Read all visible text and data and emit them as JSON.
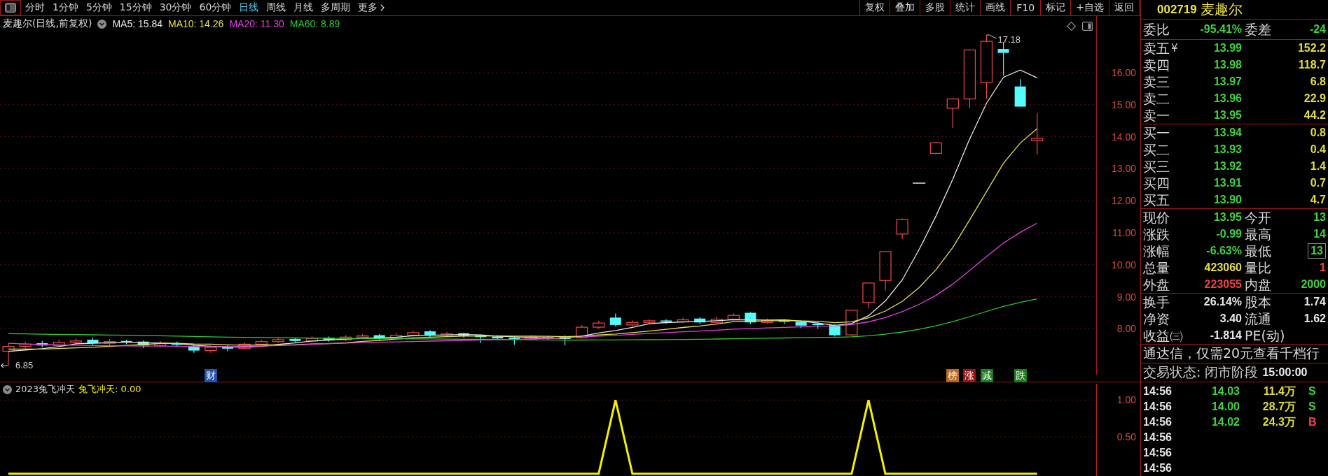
{
  "toolbar": {
    "tabs": [
      {
        "label": "分时",
        "kind": "tab",
        "selected": false
      },
      {
        "label": "1分钟",
        "kind": "tab",
        "selected": false
      },
      {
        "label": "5分钟",
        "kind": "tab",
        "selected": false
      },
      {
        "label": "15分钟",
        "kind": "tab",
        "selected": false
      },
      {
        "label": "30分钟",
        "kind": "tab",
        "selected": false
      },
      {
        "label": "60分钟",
        "kind": "tab",
        "selected": false
      },
      {
        "label": "日线",
        "kind": "tab",
        "selected": true
      },
      {
        "label": "周线",
        "kind": "tab",
        "selected": false
      },
      {
        "label": "月线",
        "kind": "tab",
        "selected": false
      },
      {
        "label": "多周期",
        "kind": "tab",
        "selected": false
      },
      {
        "label": "更多",
        "kind": "menu",
        "selected": false
      }
    ],
    "buttons": [
      "复权",
      "叠加",
      "多股",
      "统计",
      "画线",
      "F10",
      "标记",
      "+自选",
      "返回"
    ]
  },
  "main_chart": {
    "title": "麦趣尔(日线,前复权)",
    "moving_averages": [
      {
        "label": "MA5: 15.84",
        "color": "#e6e6e6"
      },
      {
        "label": "MA10: 14.26",
        "color": "#e6e048"
      },
      {
        "label": "MA20: 11.30",
        "color": "#e040e0"
      },
      {
        "label": "MA60: 8.89",
        "color": "#2ec82e"
      }
    ],
    "high_label": "17.18",
    "low_label": "6.85",
    "price_axis": [
      "16.00",
      "15.00",
      "14.00",
      "13.00",
      "12.00",
      "11.00",
      "10.00",
      "9.00",
      "8.00"
    ],
    "markers": [
      {
        "label": "财",
        "color": "#2452a8"
      },
      {
        "label": "榜",
        "color": "#b8681c"
      },
      {
        "label": "涨",
        "color": "#9a1414"
      },
      {
        "label": "减",
        "color": "#1c7e1c"
      },
      {
        "label": "跌",
        "color": "#1c7e1c"
      }
    ]
  },
  "indicator": {
    "name": "2023兔飞冲天",
    "legend": "兔飞冲天: 0.00",
    "chart_data": {
      "type": "line",
      "categories": [
        null,
        null,
        null,
        null,
        null,
        null,
        null,
        null,
        null,
        null,
        null,
        null,
        null,
        null,
        null,
        null,
        null,
        null,
        null,
        null,
        null,
        null,
        null,
        null,
        null,
        null,
        null,
        null,
        null,
        null,
        null,
        null,
        null,
        null,
        null,
        null,
        null,
        null,
        null,
        null,
        null,
        null,
        null,
        null,
        null,
        null,
        null,
        null,
        null,
        null,
        null,
        null,
        null,
        null,
        null,
        null,
        null,
        null,
        null,
        null,
        null,
        null,
        null,
        null,
        null
      ],
      "values": [
        0,
        0,
        0,
        0,
        0,
        0,
        0,
        0,
        0,
        0,
        0,
        0,
        0,
        0,
        0,
        0,
        0,
        0,
        0,
        0,
        0,
        0,
        0,
        0,
        0,
        0,
        0,
        0,
        0,
        0,
        0,
        0,
        0,
        0,
        0,
        0,
        1,
        0,
        0,
        0,
        0,
        0,
        0,
        0,
        0,
        0,
        0,
        0,
        0,
        0,
        0,
        1,
        0,
        0,
        0,
        0,
        0,
        0,
        0,
        0,
        0,
        0,
        null,
        null,
        null
      ],
      "ylim": [
        -0.03,
        1.24
      ],
      "yticks": [
        {
          "value": 1,
          "label": "1.00"
        },
        {
          "value": 0.5,
          "label": "0.50"
        }
      ]
    }
  },
  "quote_panel": {
    "code": "002719",
    "name": "麦趣尔",
    "ratio": [
      {
        "label": "委比",
        "value": "-95.41%",
        "color": "#3cd43c"
      },
      {
        "label": "委差",
        "value": "-24",
        "color": "#3cd43c"
      }
    ],
    "asks": [
      {
        "label": "卖五",
        "tag": "¥",
        "price": "13.99",
        "volume": "152.2"
      },
      {
        "label": "卖四",
        "price": "13.98",
        "volume": "118.7"
      },
      {
        "label": "卖三",
        "price": "13.97",
        "volume": "6.8"
      },
      {
        "label": "卖二",
        "price": "13.96",
        "volume": "22.9"
      },
      {
        "label": "卖一",
        "price": "13.95",
        "volume": "44.2"
      }
    ],
    "bids": [
      {
        "label": "买一",
        "price": "13.94",
        "volume": "0.8"
      },
      {
        "label": "买二",
        "price": "13.93",
        "volume": "0.4"
      },
      {
        "label": "买三",
        "price": "13.92",
        "volume": "1.4"
      },
      {
        "label": "买四",
        "price": "13.91",
        "volume": "0.7"
      },
      {
        "label": "买五",
        "price": "13.90",
        "volume": "4.7"
      }
    ],
    "quote": [
      {
        "label": "现价",
        "value": "13.95",
        "color": "#3cd43c",
        "highlighted": false
      },
      {
        "label": "今开",
        "value": "13",
        "color": "#3cd43c",
        "highlighted": false
      },
      {
        "label": "涨跌",
        "value": "-0.99",
        "color": "#3cd43c",
        "highlighted": false
      },
      {
        "label": "最高",
        "value": "14",
        "color": "#3cd43c",
        "highlighted": false
      },
      {
        "label": "涨幅",
        "value": "-6.63%",
        "color": "#3cd43c",
        "highlighted": false
      },
      {
        "label": "最低",
        "value": "13",
        "color": "#3cd43c",
        "highlighted": true
      },
      {
        "label": "总量",
        "value": "423060",
        "color": "#e4dc3c",
        "highlighted": false
      },
      {
        "label": "量比",
        "value": "1",
        "color": "#f04444",
        "highlighted": false
      },
      {
        "label": "外盘",
        "value": "223055",
        "color": "#f04444",
        "highlighted": false
      },
      {
        "label": "内盘",
        "value": "2000",
        "color": "#3cd43c",
        "highlighted": false
      }
    ],
    "fundamentals": [
      {
        "label": "换手",
        "value": "26.14%"
      },
      {
        "label": "股本",
        "value": "1.74"
      },
      {
        "label": "净资",
        "value": "3.40"
      },
      {
        "label": "流通",
        "value": "1.62"
      },
      {
        "label": "收益㈢",
        "value": "-1.814"
      },
      {
        "label": "PE(动)"
      }
    ],
    "notice": "通达信，仅需20元查看千档行",
    "status": "交易状态: 闭市阶段",
    "status_time": "15:00:00",
    "ticks": [
      {
        "time": "14:56",
        "price": "14.03",
        "volume": "11.4万",
        "side": "S",
        "color": "#3cd43c"
      },
      {
        "time": "14:56",
        "price": "14.00",
        "volume": "28.7万",
        "side": "S",
        "color": "#3cd43c"
      },
      {
        "time": "14:56",
        "price": "14.02",
        "volume": "24.3万",
        "side": "B",
        "color": "#f04444"
      },
      {
        "time": "14:56"
      },
      {
        "time": "14:56"
      },
      {
        "time": "14:56"
      }
    ]
  }
}
